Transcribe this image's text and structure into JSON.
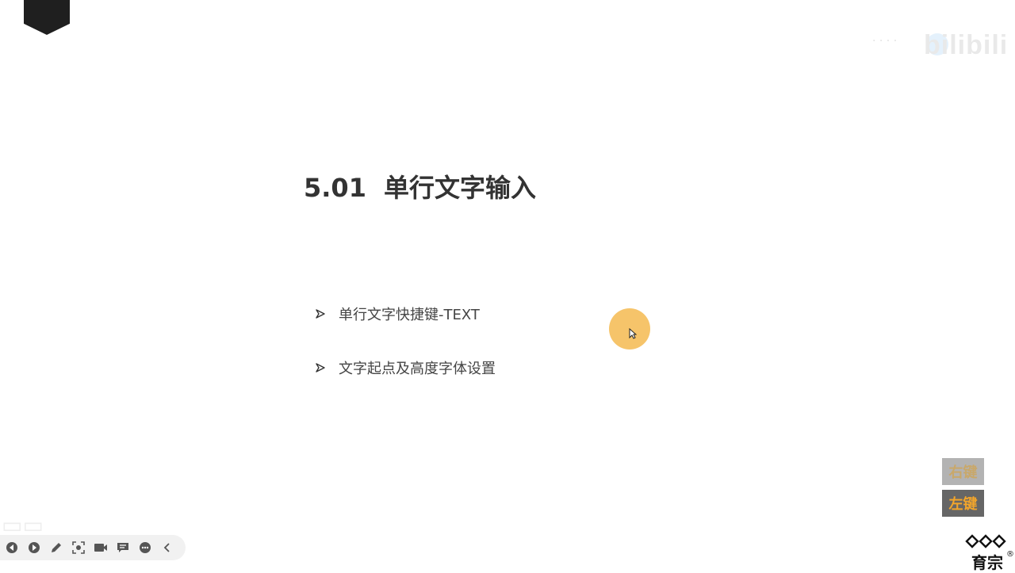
{
  "slide": {
    "section_number": "5.01",
    "section_title": "单行文字输入",
    "bullets": [
      {
        "text": "单行文字快捷键-TEXT"
      },
      {
        "text": "文字起点及高度字体设置"
      }
    ]
  },
  "mouse_indicator": {
    "right_key_label": "右键",
    "left_key_label": "左键",
    "highlight_color": "#F4B749"
  },
  "watermark": {
    "text": "bilibili"
  },
  "brand": {
    "name": "育宗",
    "registered": "®"
  },
  "toolbar": {
    "icons": [
      "prev-icon",
      "next-icon",
      "pen-icon",
      "screenshot-icon",
      "camera-icon",
      "comment-icon",
      "more-icon",
      "collapse-icon"
    ]
  }
}
